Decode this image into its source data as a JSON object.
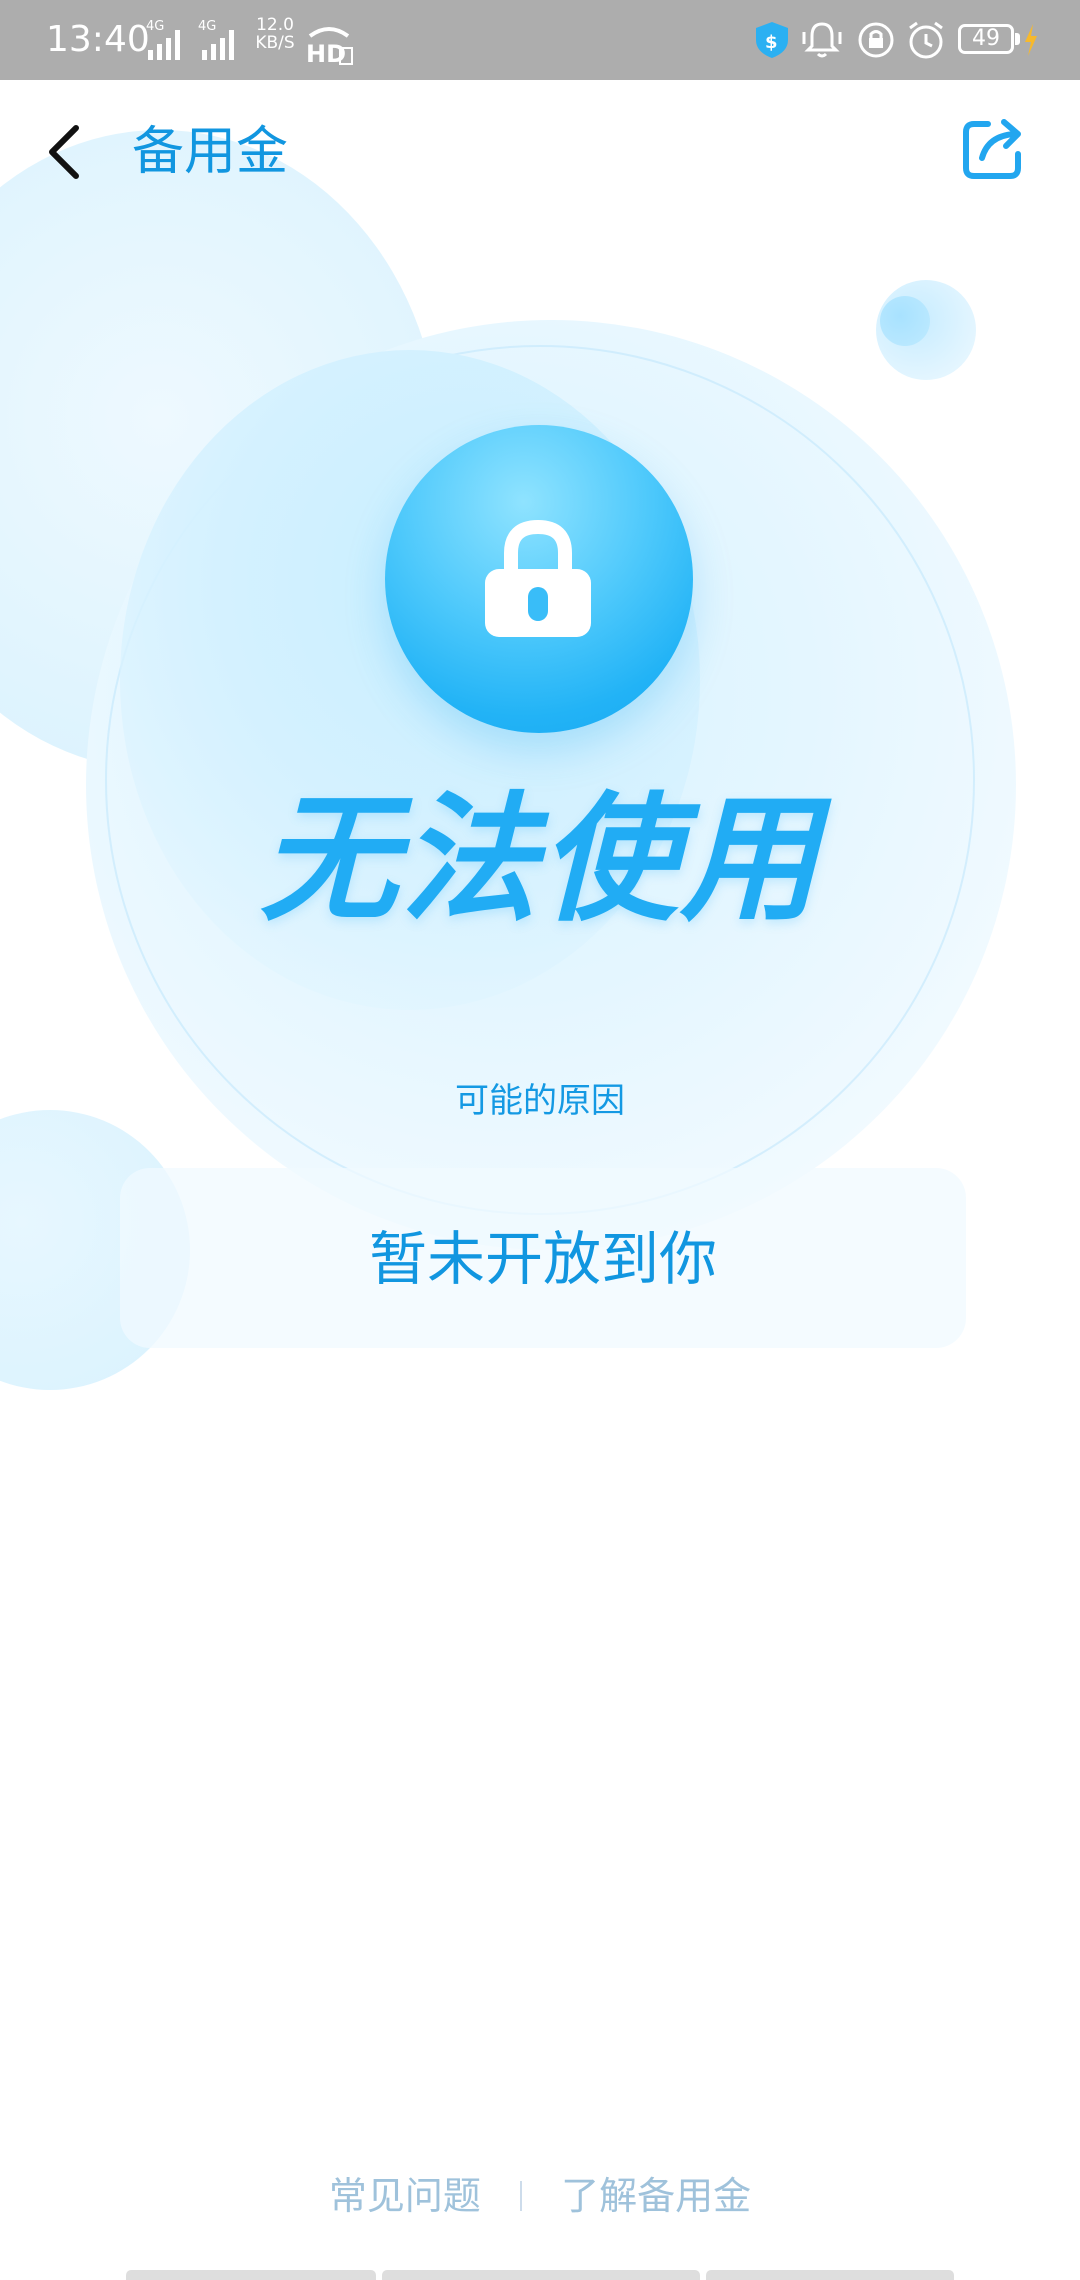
{
  "status_bar": {
    "time": "13:40",
    "sim1_tag": "4G",
    "sim2_tag": "4G",
    "speed_value": "12.0",
    "speed_unit": "KB/S",
    "battery_level": "49"
  },
  "header": {
    "title": "备用金",
    "back_icon": "chevron-left-icon",
    "share_icon": "share-icon"
  },
  "status": {
    "icon": "lock-icon",
    "title": "无法使用",
    "reason_label": "可能的原因",
    "reason": "暂未开放到你"
  },
  "footer": {
    "faq_label": "常见问题",
    "about_label": "了解备用金"
  },
  "colors": {
    "brand_blue": "#1196e0",
    "headline_blue": "#21acf4",
    "footer_link": "#9fc2db",
    "status_bar": "#adadad"
  }
}
